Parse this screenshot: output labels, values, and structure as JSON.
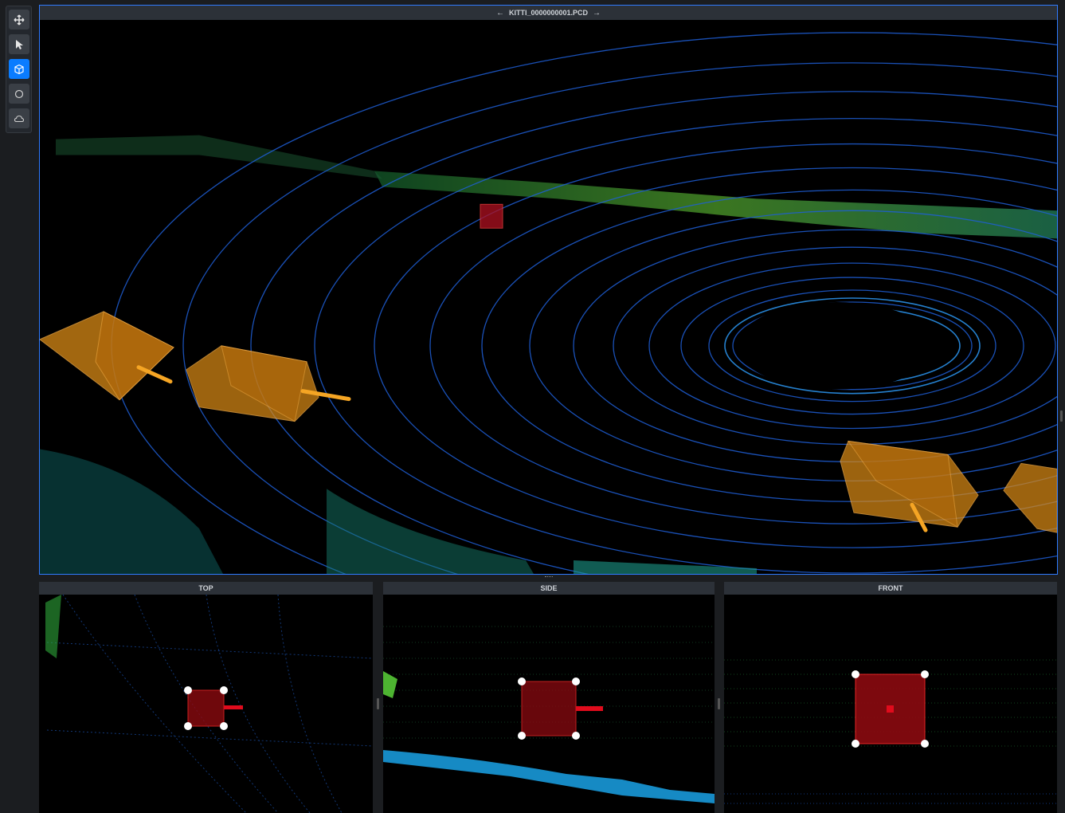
{
  "toolbar": {
    "tools": [
      {
        "name": "move",
        "icon": "move-arrows-icon",
        "active": false
      },
      {
        "name": "select",
        "icon": "cursor-icon",
        "active": false
      },
      {
        "name": "cuboid",
        "icon": "cube-icon",
        "active": true
      },
      {
        "name": "circle",
        "icon": "circle-icon",
        "active": false
      },
      {
        "name": "cloud",
        "icon": "cloud-icon",
        "active": false
      }
    ]
  },
  "main_view": {
    "title": "KITTI_0000000001.PCD",
    "prev_icon": "arrow-left-icon",
    "next_icon": "arrow-right-icon"
  },
  "subviews": [
    {
      "title": "TOP"
    },
    {
      "title": "SIDE"
    },
    {
      "title": "FRONT"
    }
  ],
  "colors": {
    "accent": "#0a7cff",
    "cuboid_fill": "#d98a16",
    "selected_box": "#8b0a10",
    "selected_border": "#ff2a2a",
    "heading_bar": "#e00b1c"
  }
}
